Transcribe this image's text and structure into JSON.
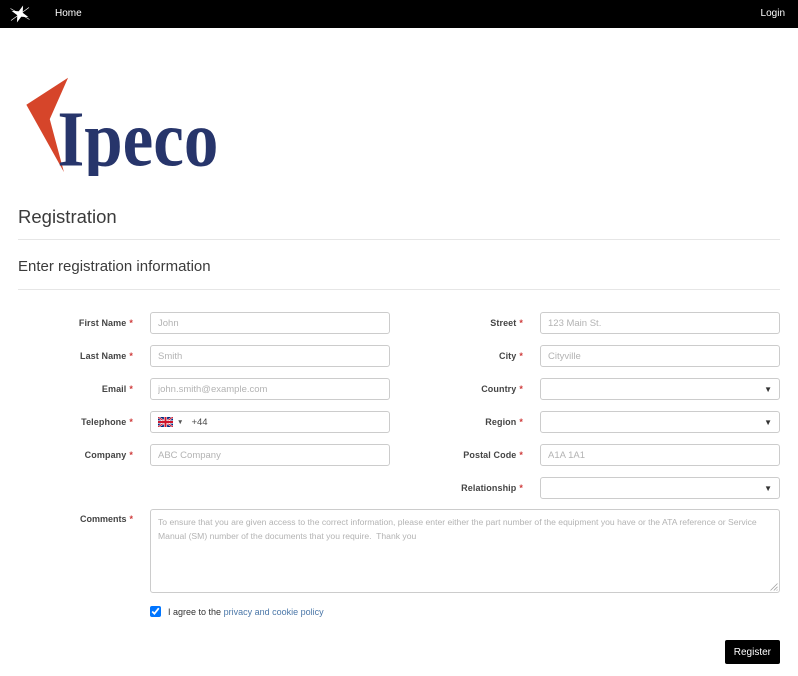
{
  "nav": {
    "home_label": "Home",
    "login_label": "Login"
  },
  "logo": {
    "wordmark": "Ipeco",
    "mark_color": "#d6452a",
    "text_color": "#27356b"
  },
  "page": {
    "title": "Registration",
    "section_title": "Enter registration information"
  },
  "form": {
    "required_marker": "*",
    "left_fields": [
      {
        "label": "First Name",
        "placeholder": "John"
      },
      {
        "label": "Last Name",
        "placeholder": "Smith"
      },
      {
        "label": "Email",
        "placeholder": "john.smith@example.com"
      },
      {
        "label": "Telephone",
        "dial_code": "+44",
        "flag": "united-kingdom-flag-icon"
      },
      {
        "label": "Company",
        "placeholder": "ABC Company"
      }
    ],
    "right_fields": [
      {
        "label": "Street",
        "placeholder": "123 Main St."
      },
      {
        "label": "City",
        "placeholder": "Cityville"
      },
      {
        "label": "Country",
        "value": ""
      },
      {
        "label": "Region",
        "value": ""
      },
      {
        "label": "Postal Code",
        "placeholder": "A1A 1A1"
      },
      {
        "label": "Relationship",
        "value": ""
      }
    ],
    "comments": {
      "label": "Comments",
      "placeholder": "To ensure that you are given access to the correct information, please enter either the part number of the equipment you have or the ATA reference or Service Manual (SM) number of the documents that you require.  Thank you"
    },
    "consent": {
      "text_before": "I agree to the",
      "link_text": "privacy and cookie policy",
      "checked": true
    },
    "submit_label": "Register"
  }
}
